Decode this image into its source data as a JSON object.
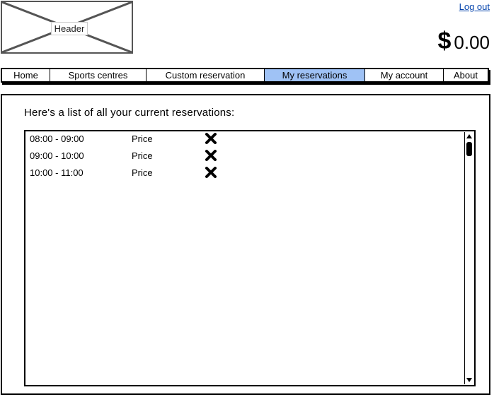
{
  "header": {
    "placeholder_label": "Header",
    "logout_label": "Log out",
    "balance_currency": "$",
    "balance_amount": "0.00"
  },
  "nav": {
    "tabs": [
      {
        "label": "Home"
      },
      {
        "label": "Sports centres"
      },
      {
        "label": "Custom reservation"
      },
      {
        "label": "My reservations",
        "active": true
      },
      {
        "label": "My account"
      },
      {
        "label": "About"
      }
    ],
    "active_color": "#9fc2f5"
  },
  "main": {
    "title": "Here's a list of all your current reservations:",
    "reservations": [
      {
        "time": "08:00 - 09:00",
        "price": "Price",
        "delete_icon": "x-icon"
      },
      {
        "time": "09:00 - 10:00",
        "price": "Price",
        "delete_icon": "x-icon"
      },
      {
        "time": "10:00 - 11:00",
        "price": "Price",
        "delete_icon": "x-icon"
      }
    ]
  }
}
